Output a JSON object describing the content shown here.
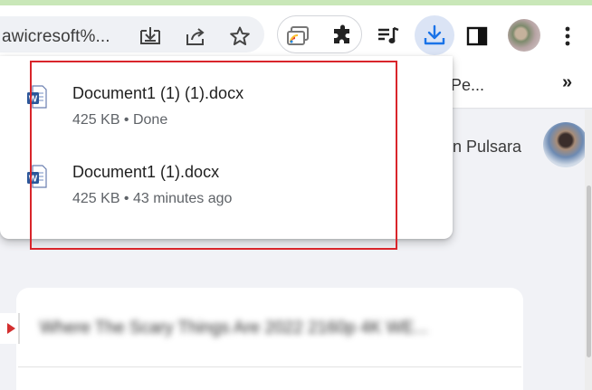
{
  "browser": {
    "address_bar": {
      "url_fragment": "awicresoft%..."
    },
    "bookmarks_bar": {
      "partial_bookmark": "Pe...",
      "more_glyph": "»"
    },
    "colors": {
      "accent": "#1a73e8",
      "active_button_bg": "#dbe4f5",
      "annotation_red": "#d9252b"
    },
    "icons": [
      "install-app-icon",
      "share-icon",
      "bookmark-star-icon",
      "cast-icon",
      "extensions-icon",
      "media-queue-icon",
      "download-icon",
      "side-panel-icon",
      "profile-avatar",
      "menu-icon"
    ]
  },
  "downloads_bubble": {
    "items": [
      {
        "filename": "Document1 (1) (1).docx",
        "status": "425 KB • Done",
        "icon": "word-file-icon"
      },
      {
        "filename": "Document1 (1).docx",
        "status": "425 KB • 43 minutes ago",
        "icon": "word-file-icon"
      }
    ]
  },
  "page": {
    "user_name_partial": "n Pulsara",
    "video_card_title": "Where The Scary Things Are 2022 2160p 4K WE..."
  }
}
